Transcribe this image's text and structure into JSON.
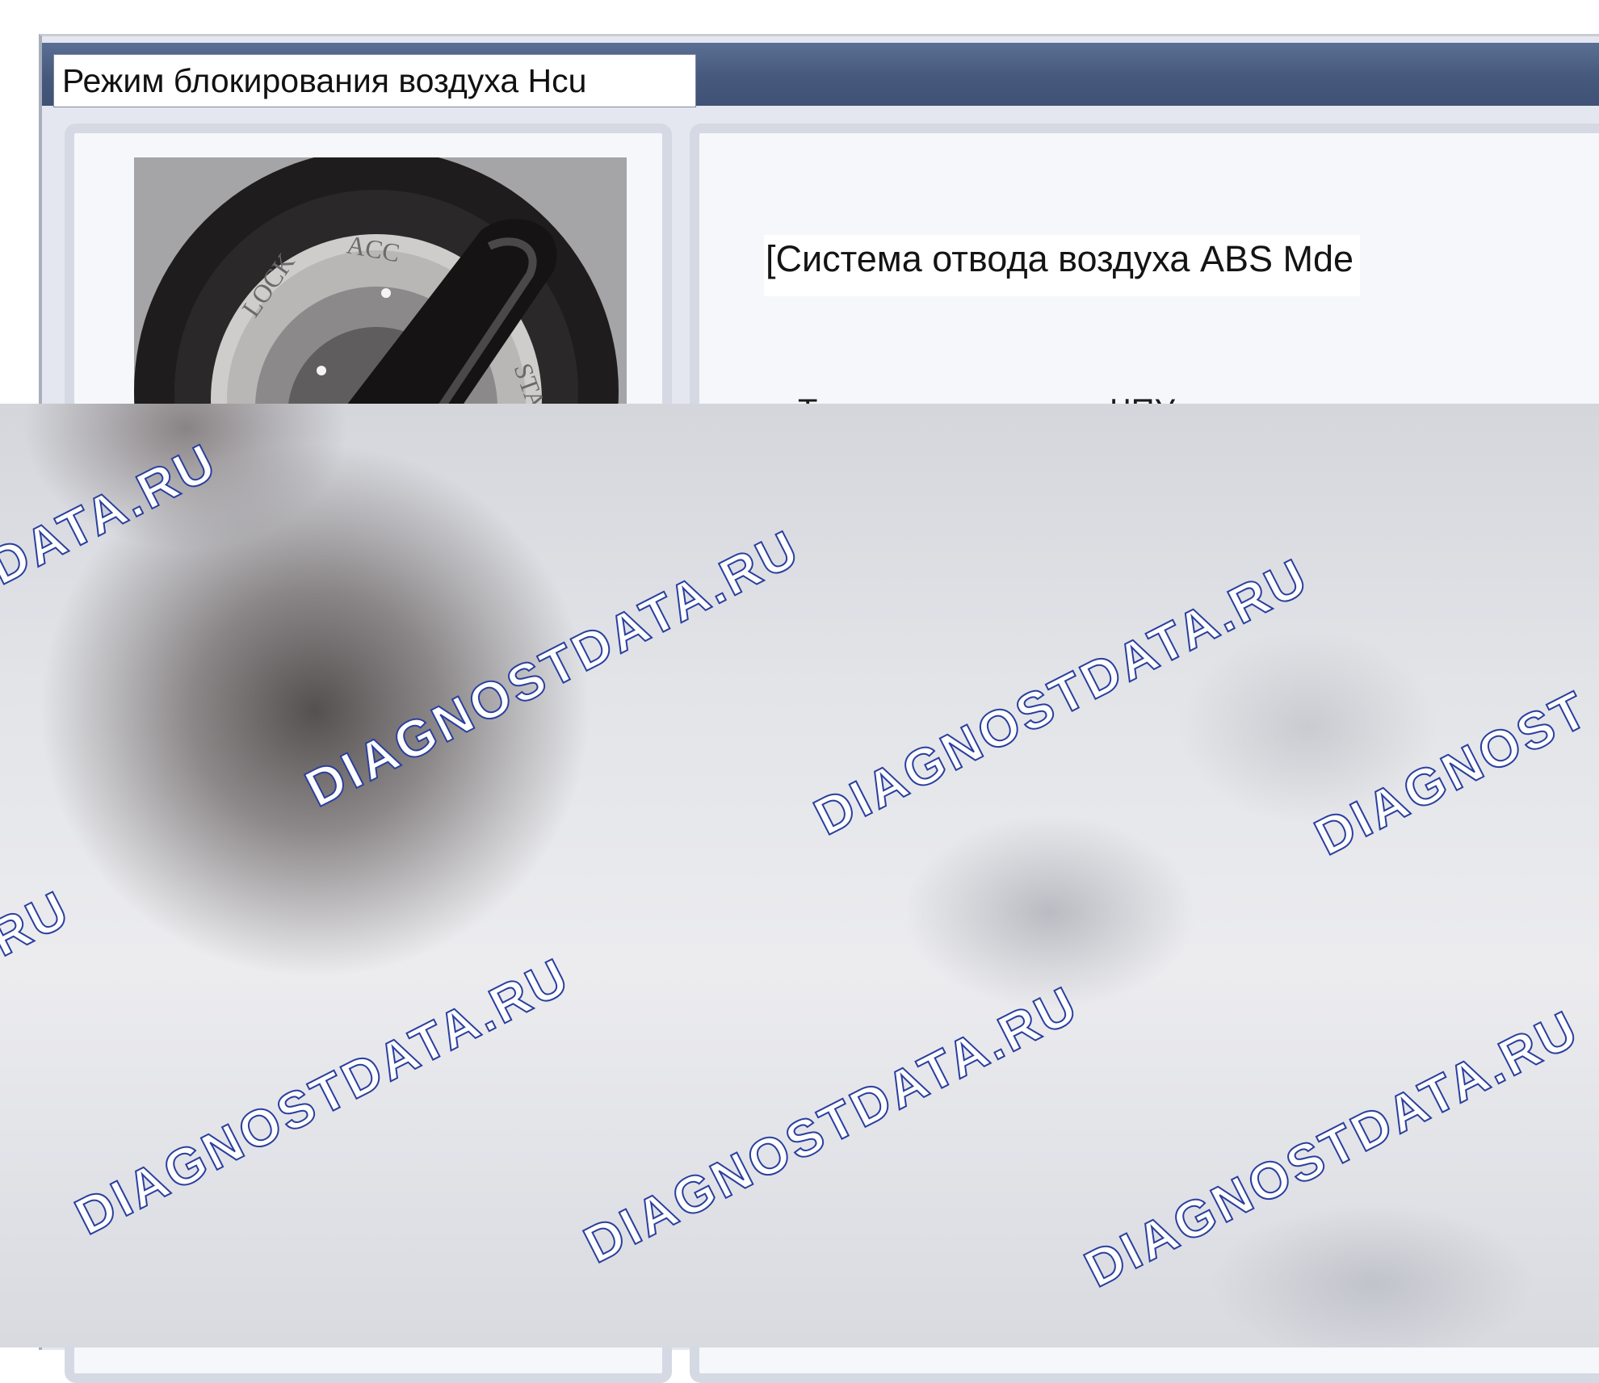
{
  "window": {
    "title": "Режим блокирования воздуха Hcu"
  },
  "content": {
    "heading": "[Система отвода воздуха ABS Mde",
    "body_text_partial": "Теперь все клапаны ЧПУ и двигатель"
  },
  "image": {
    "icon": "ignition-switch-icon",
    "markings": [
      "LOCK",
      "ACC",
      "START"
    ]
  },
  "watermark": {
    "text": "DIAGNOSTDATA.RU",
    "partial_left": "OSTDATA.RU",
    "partial_right": "DIAGNOST",
    "partial_ru": ".RU",
    "color": "#2a3f9e"
  },
  "colors": {
    "title_bar": "#46597d",
    "panel_border": "#d5d9e3"
  }
}
